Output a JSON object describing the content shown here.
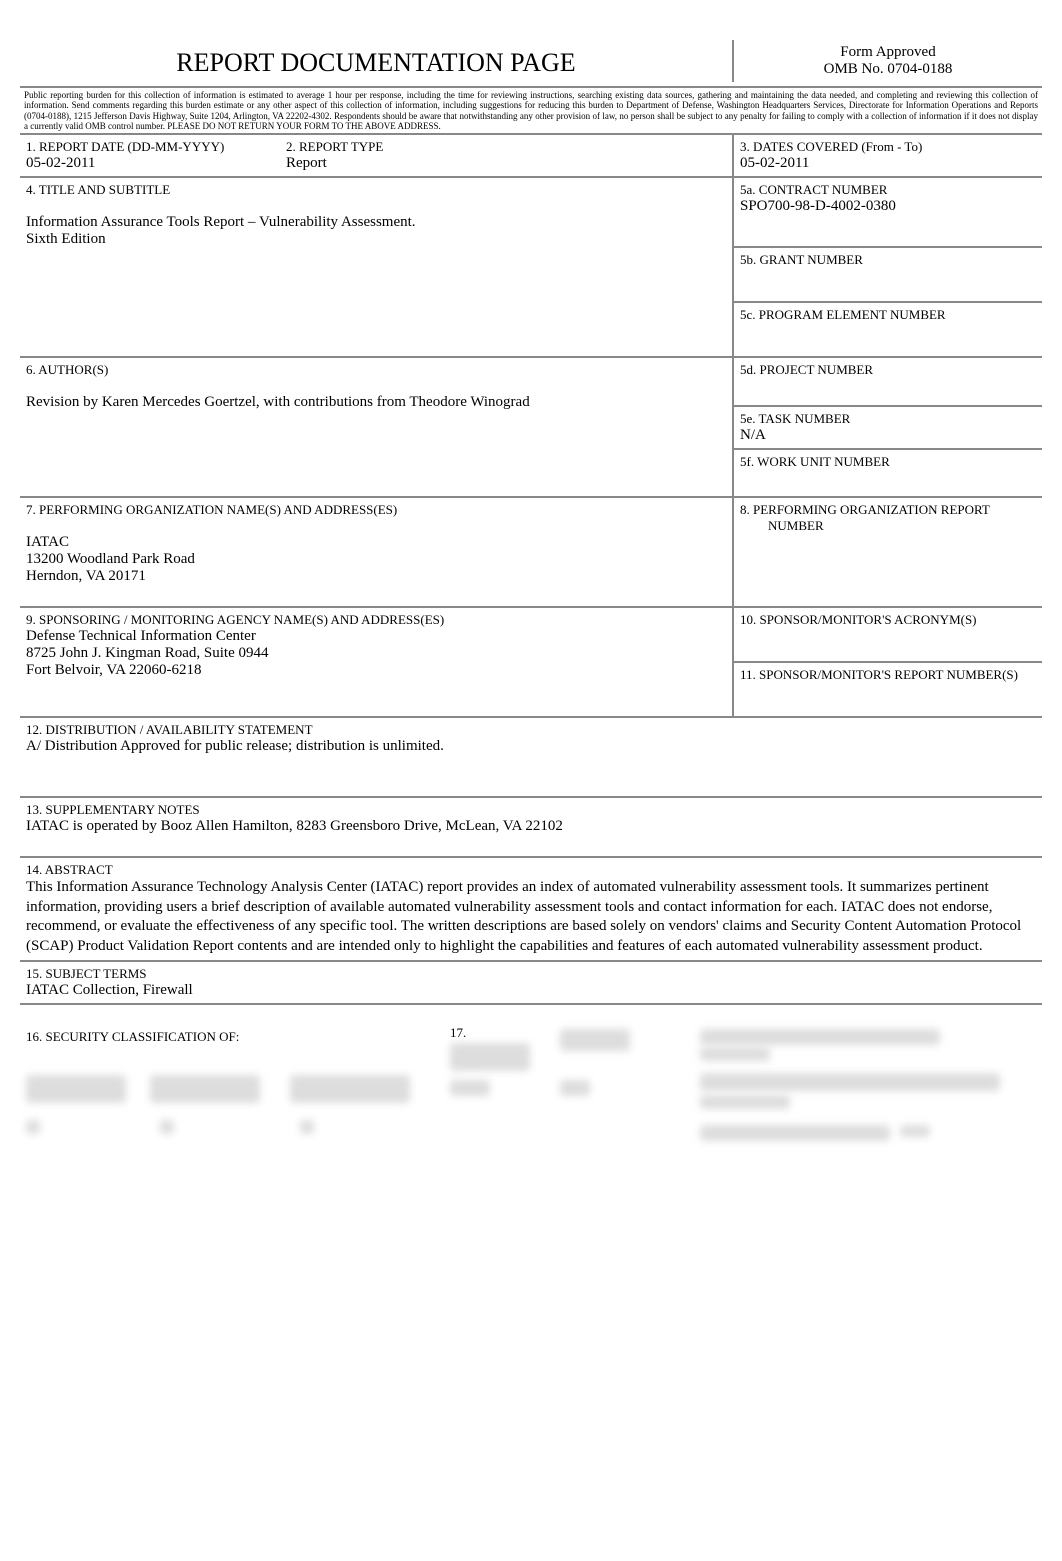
{
  "header": {
    "title": "REPORT DOCUMENTATION PAGE",
    "form_approved": "Form Approved",
    "omb": "OMB No. 0704-0188"
  },
  "burden_statement": "Public reporting burden for this collection of information is estimated to average 1 hour per response, including the time for reviewing instructions, searching existing data sources, gathering and maintaining the data needed, and completing and reviewing this collection of information.  Send comments regarding this burden estimate or any other aspect of this collection of information, including suggestions for reducing this burden to Department of Defense, Washington Headquarters Services, Directorate for Information Operations and Reports (0704-0188), 1215 Jefferson Davis Highway, Suite 1204, Arlington, VA   22202-4302.  Respondents should be aware that notwithstanding any other provision of law, no person shall be subject to any penalty for failing to comply with a collection of information if it does not display a currently valid OMB control number.  PLEASE DO NOT RETURN YOUR FORM TO THE ABOVE ADDRESS.",
  "field1": {
    "label": "1. REPORT DATE   (DD-MM-YYYY)",
    "value": "05-02-2011"
  },
  "field2": {
    "label": "2. REPORT TYPE",
    "value": "Report"
  },
  "field3": {
    "label": "3. DATES COVERED   (From - To)",
    "value": "05-02-2011"
  },
  "field4": {
    "label": "4. TITLE AND SUBTITLE",
    "value_line1": "Information Assurance Tools Report – Vulnerability Assessment.",
    "value_line2": "Sixth Edition"
  },
  "field5a": {
    "label": "5a. CONTRACT NUMBER",
    "value": "SPO700-98-D-4002-0380"
  },
  "field5b": {
    "label": "5b. GRANT NUMBER"
  },
  "field5c": {
    "label": "5c. PROGRAM ELEMENT NUMBER"
  },
  "field5d": {
    "label": "5d. PROJECT NUMBER"
  },
  "field5e": {
    "label": "5e. TASK NUMBER",
    "value": "N/A"
  },
  "field5f": {
    "label": "5f. WORK UNIT NUMBER"
  },
  "field6": {
    "label": "6. AUTHOR(S)",
    "value": "Revision by Karen Mercedes Goertzel, with contributions from Theodore Winograd"
  },
  "field7": {
    "label": "7. PERFORMING ORGANIZATION NAME(S) AND ADDRESS(ES)",
    "line1": "IATAC",
    "line2": "13200 Woodland Park Road",
    "line3": "Herndon, VA 20171"
  },
  "field8": {
    "label": "8. PERFORMING ORGANIZATION REPORT",
    "label2": "NUMBER"
  },
  "field9": {
    "label": "9. SPONSORING / MONITORING AGENCY NAME(S) AND ADDRESS(ES)",
    "line1": "Defense Technical Information Center",
    "line2": "8725 John J. Kingman Road, Suite 0944",
    "line3": "Fort Belvoir, VA 22060-6218"
  },
  "field10": {
    "label": "10. SPONSOR/MONITOR'S ACRONYM(S)"
  },
  "field11": {
    "label": "11. SPONSOR/MONITOR'S REPORT NUMBER(S)"
  },
  "field12": {
    "label": "12. DISTRIBUTION / AVAILABILITY STATEMENT",
    "value": "A/ Distribution Approved for public release; distribution is unlimited."
  },
  "field13": {
    "label": "13. SUPPLEMENTARY NOTES",
    "value": "IATAC is operated by Booz Allen Hamilton, 8283 Greensboro Drive, McLean, VA 22102"
  },
  "field14": {
    "label": "14. ABSTRACT",
    "value": "This Information Assurance Technology Analysis Center (IATAC) report provides an index of automated vulnerability assessment tools.  It summarizes pertinent information, providing users a brief description of available automated vulnerability assessment tools and contact information for each. IATAC does not endorse, recommend, or evaluate the effectiveness of any specific tool. The written descriptions are based solely on vendors' claims and Security Content Automation Protocol (SCAP) Product Validation Report contents and are intended only to highlight the capabilities and features of each automated vulnerability assessment product."
  },
  "field15": {
    "label": "15. SUBJECT TERMS",
    "value": "IATAC Collection, Firewall"
  },
  "field16": {
    "label": "16. SECURITY CLASSIFICATION OF:"
  },
  "field17": {
    "label": "17."
  }
}
